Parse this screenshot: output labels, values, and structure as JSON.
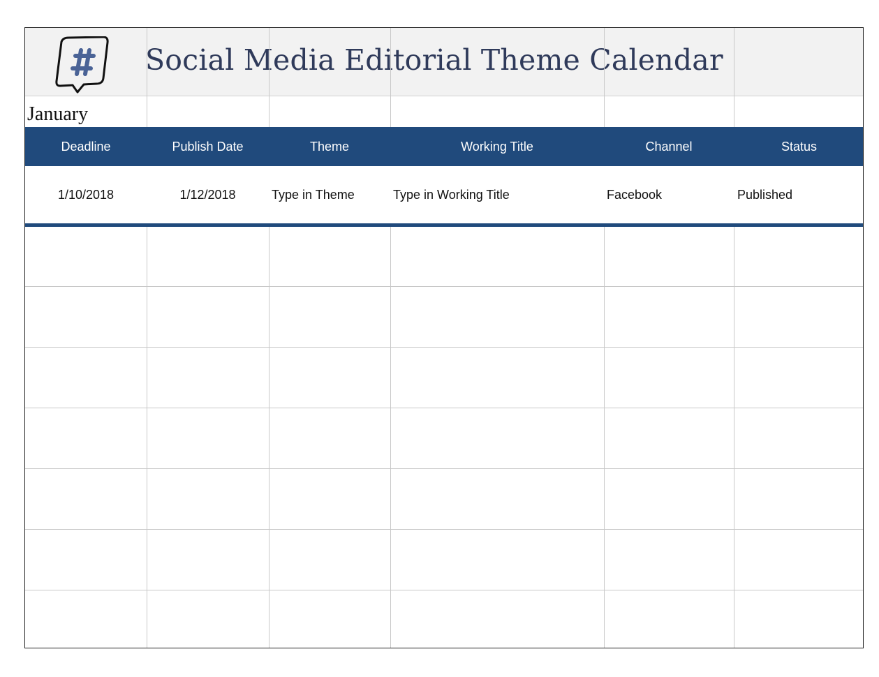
{
  "title": "Social Media Editorial Theme Calendar",
  "logo_icon": "hashtag-speech-bubble-icon",
  "month": "January",
  "columns": [
    "Deadline",
    "Publish Date",
    "Theme",
    "Working Title",
    "Channel",
    "Status"
  ],
  "rows": [
    {
      "deadline": "1/10/2018",
      "publish_date": "1/12/2018",
      "theme": "Type in Theme",
      "working_title": "Type in Working Title",
      "channel": "Facebook",
      "status": "Published"
    }
  ],
  "colors": {
    "header": "#204a7c",
    "title": "#2f3a5a",
    "band": "#f2f2f2"
  }
}
